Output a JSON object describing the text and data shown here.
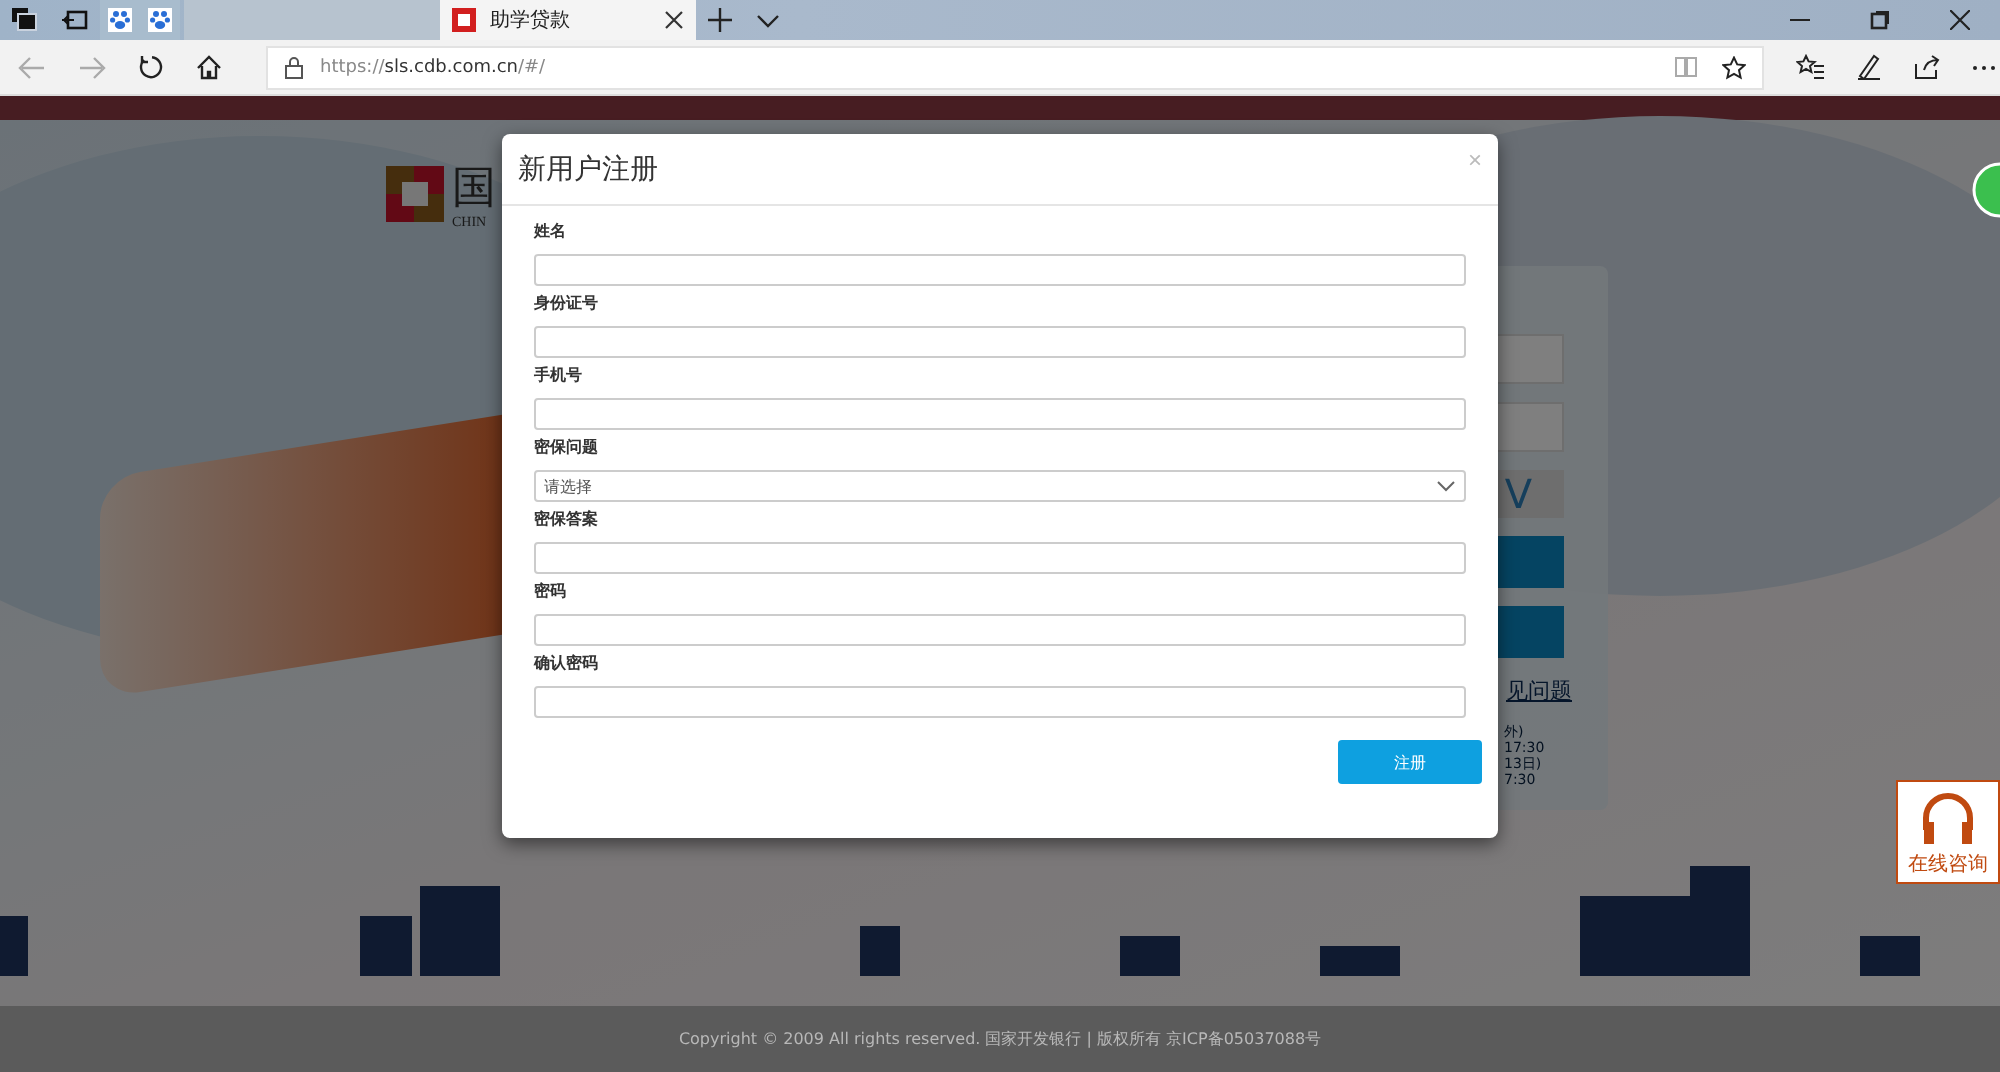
{
  "browser": {
    "tabs": [
      {
        "kind": "pinned",
        "selected": false
      },
      {
        "kind": "pinned",
        "selected": false
      },
      {
        "kind": "blank",
        "selected": false
      },
      {
        "kind": "page",
        "label": "助学贷款",
        "selected": true
      }
    ],
    "url_scheme": "https://",
    "url_host": "sls.cdb.com.cn",
    "url_path": "/#/"
  },
  "page": {
    "logo_text": "国",
    "logo_subtext": "CHIN",
    "captcha_text": "V",
    "help_link": "见问题",
    "hours": [
      "外)",
      "17:30",
      "13日)",
      "7:30"
    ],
    "consult_label": "在线咨询",
    "footer": "Copyright © 2009 All rights reserved. 国家开发银行 | 版权所有 京ICP备05037088号"
  },
  "modal": {
    "title": "新用户注册",
    "close": "×",
    "fields": [
      {
        "kind": "text",
        "label": "姓名"
      },
      {
        "kind": "text",
        "label": "身份证号"
      },
      {
        "kind": "text",
        "label": "手机号"
      },
      {
        "kind": "select",
        "label": "密保问题",
        "placeholder": "请选择"
      },
      {
        "kind": "text",
        "label": "密保答案"
      },
      {
        "kind": "text",
        "label": "密码"
      },
      {
        "kind": "text",
        "label": "确认密码"
      }
    ],
    "submit": "注册"
  }
}
